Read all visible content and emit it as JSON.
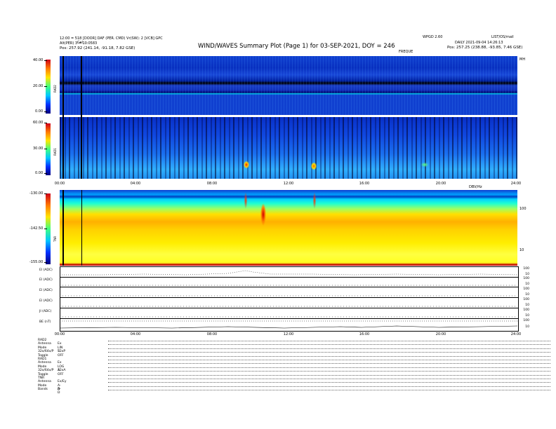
{
  "header": {
    "title": "WIND/WAVES Summary Plot (Page 1) for 03-SEP-2021, DOY = 246",
    "left_line1": "12:00 = 518  [DOOR]  DAF  (PER.  CMD)  Vr(SW):  2  [VCB]  GPC",
    "left_line2": "Alt(PER) 3 = 10:0583",
    "left_pos": "Pos:   257.92 (241.14, -91.18, 7.82 GSE)",
    "right_id1": "WPGD 2.60",
    "right_id2": "LIST/OS/mail",
    "right_line2": "DAILY  2021-09-04  14:26:13",
    "right_pos": "Pos:   257.25 (238.88, -93.85, 7.46 GSE)",
    "cal_label": "Cal",
    "freq_label": "FREQUE"
  },
  "panels": {
    "rad2": {
      "label": "RAD2",
      "ticks": [
        "40.00",
        "20.00",
        "0.00"
      ],
      "top_right": "MH"
    },
    "rad1": {
      "label": "RAD1",
      "ticks": [
        "60.00",
        "30.00",
        "0.00"
      ]
    },
    "tnr": {
      "label": "TNR",
      "ticks": [
        "-130.00",
        "-142.50",
        "-155.00"
      ],
      "right_ticks": [
        "100",
        "10"
      ],
      "top_right": "DBV/Hz"
    }
  },
  "time_axis": [
    "00:00",
    "04:00",
    "08:00",
    "12:00",
    "16:00",
    "20:00",
    "24:00"
  ],
  "time_series": [
    {
      "name": "EI (ADC)",
      "right": [
        "100",
        "10"
      ]
    },
    {
      "name": "EI (ADC)",
      "right": [
        "100",
        "10"
      ]
    },
    {
      "name": "EI (ADC)",
      "right": [
        "100",
        "10"
      ]
    },
    {
      "name": "EI (ADC)",
      "right": [
        "100",
        "10"
      ]
    },
    {
      "name": "JI (ADC)",
      "right": [
        "100",
        "10"
      ]
    },
    {
      "name": "BE (nT)",
      "right": [
        "100",
        "10"
      ]
    }
  ],
  "footer": [
    {
      "k": "RAD2",
      "v": ""
    },
    {
      "k": "Antenna",
      "v": "Ex"
    },
    {
      "k": "Mode",
      "v": "LIN S"
    },
    {
      "k": "32x/64x/P",
      "v": "32xP"
    },
    {
      "k": "Toggle",
      "v": "OFF"
    },
    {
      "k": "RAD1",
      "v": ""
    },
    {
      "k": "Antenna",
      "v": "Ex"
    },
    {
      "k": "Mode",
      "v": "LOG A"
    },
    {
      "k": "32x/64x/P",
      "v": "32xA"
    },
    {
      "k": "Toggle",
      "v": "OFF"
    },
    {
      "k": "TNR",
      "v": ""
    },
    {
      "k": "Antenna",
      "v": "Ex/Ey"
    },
    {
      "k": "Mode",
      "v": "A-D"
    },
    {
      "k": "Bands",
      "v": "A-D"
    }
  ],
  "chart_data": [
    {
      "type": "heatmap",
      "title": "RAD2",
      "ylabel": "RAD2",
      "ylim": [
        0,
        40
      ],
      "xlim": [
        "00:00",
        "24:00"
      ]
    },
    {
      "type": "heatmap",
      "title": "RAD1",
      "ylabel": "RAD1",
      "ylim": [
        0,
        60
      ],
      "xlim": [
        "00:00",
        "24:00"
      ]
    },
    {
      "type": "heatmap",
      "title": "TNR",
      "ylabel": "TNR",
      "ylim": [
        -155,
        -130
      ],
      "xlim": [
        "00:00",
        "24:00"
      ]
    }
  ]
}
